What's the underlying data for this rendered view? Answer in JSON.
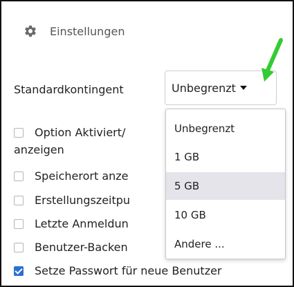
{
  "header": {
    "title": "Einstellungen",
    "icon": "gear-icon"
  },
  "quota": {
    "label": "Standardkontingent",
    "selected": "Unbegrenzt",
    "options": [
      "Unbegrenzt",
      "1 GB",
      "5 GB",
      "10 GB",
      "Andere ..."
    ],
    "highlighted": "5 GB"
  },
  "settings": {
    "items": [
      {
        "label": "Option Aktiviert/",
        "checked": false
      },
      {
        "label": "Speicherort anze",
        "checked": false
      },
      {
        "label": "Erstellungszeitpu",
        "checked": false
      },
      {
        "label": "Letzte Anmeldun",
        "checked": false
      },
      {
        "label": "Benutzer-Backen",
        "checked": false
      },
      {
        "label": "Setze Passwort für neue Benutzer",
        "checked": true
      }
    ],
    "wrap_text": "anzeigen"
  },
  "colors": {
    "checkbox_checked": "#2e6fd4",
    "arrow": "#33cc33",
    "highlight": "#e4e4ea"
  }
}
